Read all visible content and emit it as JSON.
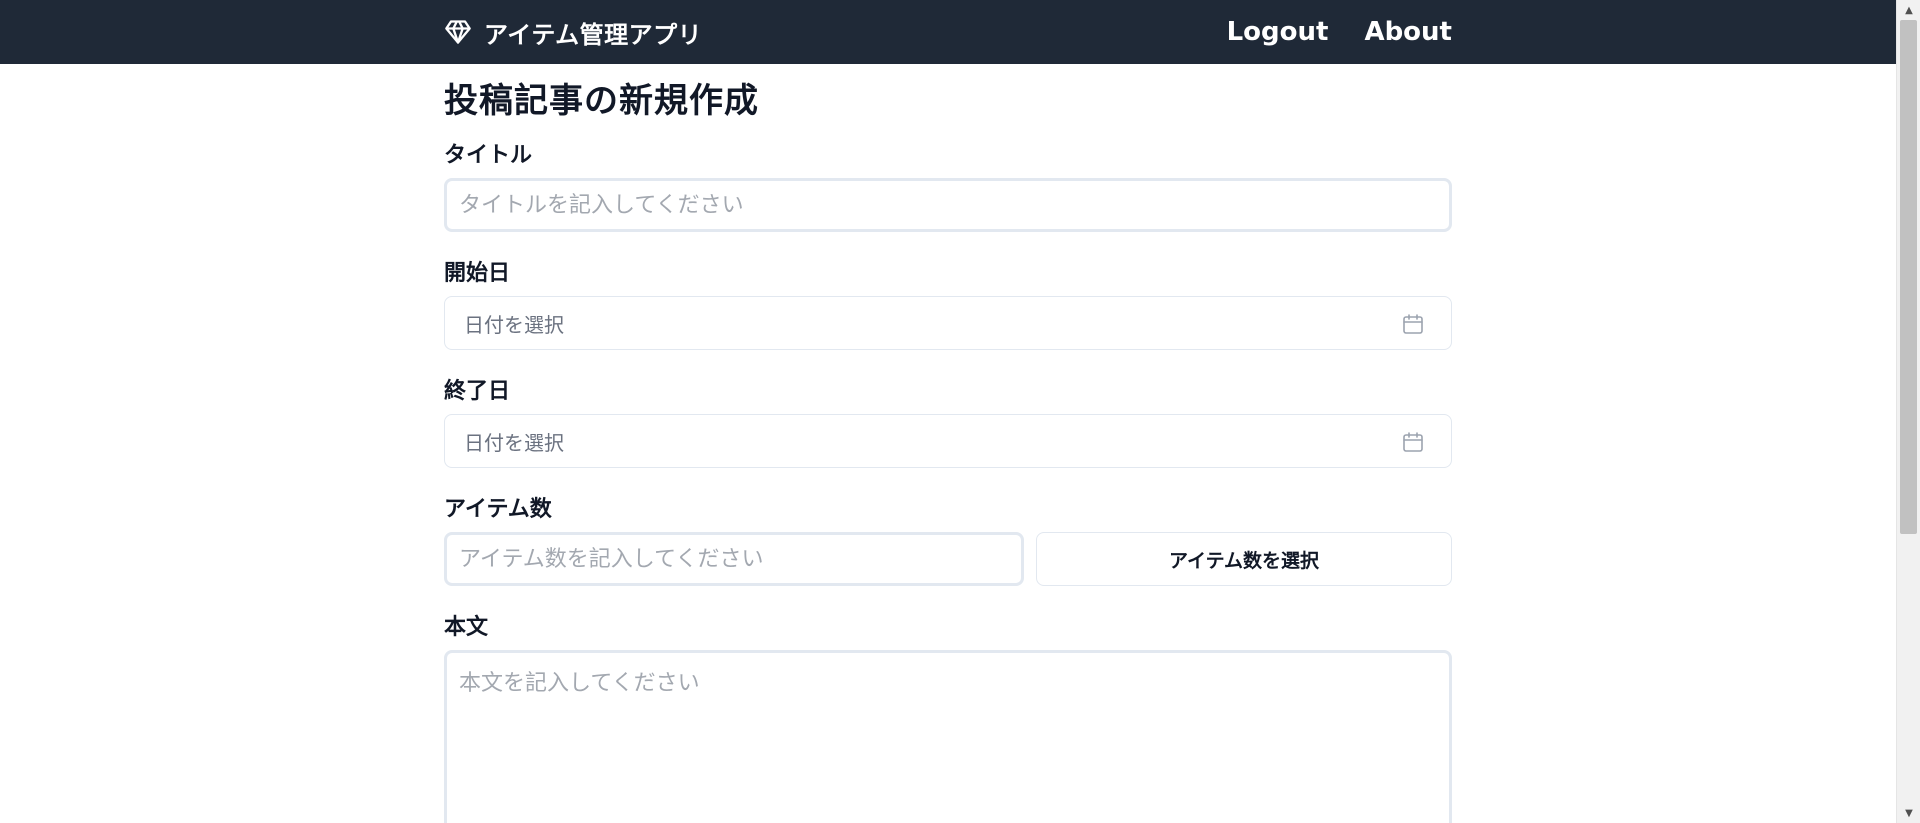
{
  "nav": {
    "brand_icon": "gem-icon",
    "brand_title": "アイテム管理アプリ",
    "links": [
      {
        "label": "Logout"
      },
      {
        "label": "About"
      }
    ]
  },
  "form": {
    "page_title": "投稿記事の新規作成",
    "title": {
      "label": "タイトル",
      "placeholder": "タイトルを記入してください",
      "value": ""
    },
    "start_date": {
      "label": "開始日",
      "placeholder": "日付を選択",
      "icon": "calendar-icon"
    },
    "end_date": {
      "label": "終了日",
      "placeholder": "日付を選択",
      "icon": "calendar-icon"
    },
    "item_count": {
      "label": "アイテム数",
      "placeholder": "アイテム数を記入してください",
      "value": "",
      "button_label": "アイテム数を選択"
    },
    "body": {
      "label": "本文",
      "placeholder": "本文を記入してください",
      "value": ""
    }
  },
  "colors": {
    "navbar_bg": "#1f2937",
    "navbar_text": "#ffffff",
    "input_border": "#e2e8f0",
    "placeholder": "#a3a8b0",
    "text": "#111827"
  }
}
